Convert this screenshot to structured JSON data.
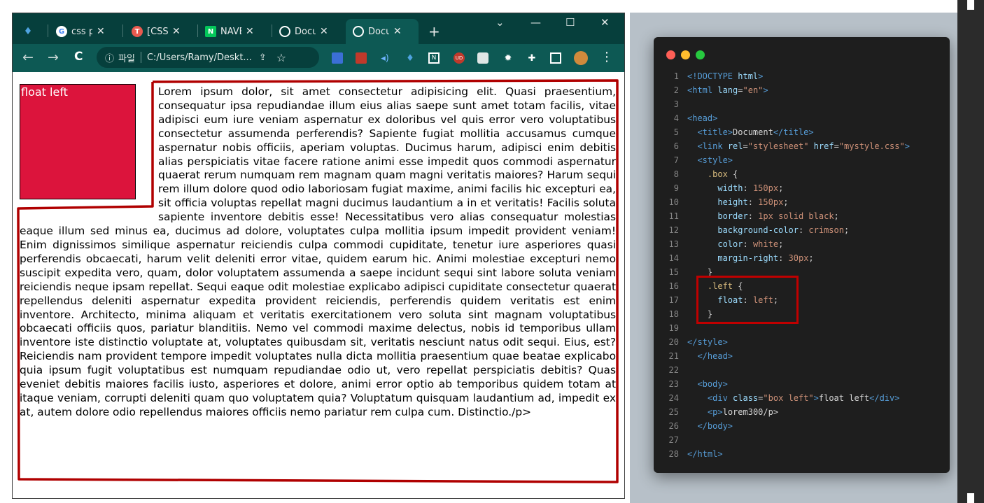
{
  "browser": {
    "tabs": [
      {
        "label": "",
        "icon": "diamond-icon",
        "color": "#4fa3e0"
      },
      {
        "label": "css pc",
        "icon": "google-icon",
        "color": "#ffffff"
      },
      {
        "label": "[CSS",
        "icon": "tistory-icon",
        "color": "#e85a4f"
      },
      {
        "label": "NAVE",
        "icon": "naver-icon",
        "color": "#03c75a"
      },
      {
        "label": "Docu",
        "icon": "globe-icon",
        "color": "#ffffff"
      },
      {
        "label": "Docu",
        "icon": "globe-icon",
        "color": "#ffffff",
        "active": true
      }
    ],
    "new_tab": "+",
    "close_glyph": "✕",
    "window_controls": {
      "dropdown": "⌄",
      "minimize": "—",
      "maximize": "☐",
      "close": "✕"
    },
    "toolbar": {
      "back": "←",
      "forward": "→",
      "reload": "C",
      "info_glyph": "ⓘ",
      "scheme": "파일",
      "url": "C:/Users/Ramy/Deskt...",
      "share_glyph": "⇪",
      "star_glyph": "☆",
      "menu_glyph": "⋮"
    },
    "page": {
      "float_box_text": "float left",
      "paragraph": "Lorem ipsum dolor, sit amet consectetur adipisicing elit. Quasi praesentium, consequatur ipsa repudiandae illum eius alias saepe sunt amet totam facilis, vitae adipisci eum iure veniam aspernatur ex doloribus vel quis error vero voluptatibus consectetur assumenda perferendis? Sapiente fugiat mollitia accusamus cumque aspernatur nobis officiis, aperiam voluptas. Ducimus harum, adipisci enim debitis alias perspiciatis vitae facere ratione animi esse impedit quos commodi aspernatur quaerat rerum numquam rem magnam quam magni veritatis maiores? Harum sequi rem illum dolore quod odio laboriosam fugiat maxime, animi facilis hic excepturi ea, sit officia voluptas repellat magni ducimus laudantium a in et veritatis! Facilis soluta sapiente inventore debitis esse! Necessitatibus vero alias consequatur molestias eaque illum sed minus ea, ducimus ad dolore, voluptates culpa mollitia ipsum impedit provident veniam! Enim dignissimos similique aspernatur reiciendis culpa commodi cupiditate, tenetur iure asperiores quasi perferendis obcaecati, harum velit deleniti error vitae, quidem earum hic. Animi molestiae excepturi nemo suscipit expedita vero, quam, dolor voluptatem assumenda a saepe incidunt sequi sint labore soluta veniam reiciendis neque ipsam repellat. Sequi eaque odit molestiae explicabo adipisci cupiditate consectetur quaerat repellendus deleniti aspernatur expedita provident reiciendis, perferendis quidem veritatis est enim inventore. Architecto, minima aliquam et veritatis exercitationem vero soluta sint magnam voluptatibus obcaecati officiis quos, pariatur blanditiis. Nemo vel commodi maxime delectus, nobis id temporibus ullam inventore iste distinctio voluptate at, voluptates quibusdam sit, veritatis nesciunt natus odit sequi. Eius, est? Reiciendis nam provident tempore impedit voluptates nulla dicta mollitia praesentium quae beatae explicabo quia ipsum fugit voluptatibus est numquam repudiandae odio ut, vero repellat perspiciatis debitis? Quas eveniet debitis maiores facilis iusto, asperiores et dolore, animi error optio ab temporibus quidem totam at itaque veniam, corrupti deleniti quam quo voluptatem quia? Voluptatum quisquam laudantium ad, impedit ex at, autem dolore odio repellendus maiores officiis nemo pariatur rem culpa cum. Distinctio./p>"
    },
    "highlight_color": "#b00000"
  },
  "code": {
    "lines": [
      {
        "n": "1",
        "parts": [
          [
            "tg",
            "<!DOCTYPE "
          ],
          [
            "at",
            "html"
          ],
          [
            "tg",
            ">"
          ]
        ]
      },
      {
        "n": "2",
        "parts": [
          [
            "tg",
            "<html "
          ],
          [
            "at",
            "lang"
          ],
          [
            "tx",
            "="
          ],
          [
            "st",
            "\"en\""
          ],
          [
            "tg",
            ">"
          ]
        ]
      },
      {
        "n": "3",
        "parts": []
      },
      {
        "n": "4",
        "parts": [
          [
            "tg",
            "<head>"
          ]
        ]
      },
      {
        "n": "5",
        "parts": [
          [
            "tx",
            "  "
          ],
          [
            "tg",
            "<title>"
          ],
          [
            "tx",
            "Document"
          ],
          [
            "tg",
            "</title>"
          ]
        ]
      },
      {
        "n": "6",
        "parts": [
          [
            "tx",
            "  "
          ],
          [
            "tg",
            "<link "
          ],
          [
            "at",
            "rel"
          ],
          [
            "tx",
            "="
          ],
          [
            "st",
            "\"stylesheet\""
          ],
          [
            "tx",
            " "
          ],
          [
            "at",
            "href"
          ],
          [
            "tx",
            "="
          ],
          [
            "st",
            "\"mystyle.css\""
          ],
          [
            "tg",
            ">"
          ]
        ]
      },
      {
        "n": "7",
        "parts": [
          [
            "tx",
            "  "
          ],
          [
            "tg",
            "<style>"
          ]
        ]
      },
      {
        "n": "8",
        "parts": [
          [
            "tx",
            "    "
          ],
          [
            "sel",
            ".box"
          ],
          [
            "tx",
            " {"
          ]
        ]
      },
      {
        "n": "9",
        "parts": [
          [
            "tx",
            "      "
          ],
          [
            "pr",
            "width"
          ],
          [
            "tx",
            ": "
          ],
          [
            "vl",
            "150px"
          ],
          [
            "tx",
            ";"
          ]
        ]
      },
      {
        "n": "10",
        "parts": [
          [
            "tx",
            "      "
          ],
          [
            "pr",
            "height"
          ],
          [
            "tx",
            ": "
          ],
          [
            "vl",
            "150px"
          ],
          [
            "tx",
            ";"
          ]
        ]
      },
      {
        "n": "11",
        "parts": [
          [
            "tx",
            "      "
          ],
          [
            "pr",
            "border"
          ],
          [
            "tx",
            ": "
          ],
          [
            "vl",
            "1px solid black"
          ],
          [
            "tx",
            ";"
          ]
        ]
      },
      {
        "n": "12",
        "parts": [
          [
            "tx",
            "      "
          ],
          [
            "pr",
            "background-color"
          ],
          [
            "tx",
            ": "
          ],
          [
            "vl",
            "crimson"
          ],
          [
            "tx",
            ";"
          ]
        ]
      },
      {
        "n": "13",
        "parts": [
          [
            "tx",
            "      "
          ],
          [
            "pr",
            "color"
          ],
          [
            "tx",
            ": "
          ],
          [
            "vl",
            "white"
          ],
          [
            "tx",
            ";"
          ]
        ]
      },
      {
        "n": "14",
        "parts": [
          [
            "tx",
            "      "
          ],
          [
            "pr",
            "margin-right"
          ],
          [
            "tx",
            ": "
          ],
          [
            "vl",
            "30px"
          ],
          [
            "tx",
            ";"
          ]
        ]
      },
      {
        "n": "15",
        "parts": [
          [
            "tx",
            "    }"
          ]
        ]
      },
      {
        "n": "16",
        "parts": [
          [
            "tx",
            "    "
          ],
          [
            "sel",
            ".left"
          ],
          [
            "tx",
            " {"
          ]
        ]
      },
      {
        "n": "17",
        "parts": [
          [
            "tx",
            "      "
          ],
          [
            "pr",
            "float"
          ],
          [
            "tx",
            ": "
          ],
          [
            "vl",
            "left"
          ],
          [
            "tx",
            ";"
          ]
        ]
      },
      {
        "n": "18",
        "parts": [
          [
            "tx",
            "    }"
          ]
        ]
      },
      {
        "n": "19",
        "parts": []
      },
      {
        "n": "20",
        "parts": [
          [
            "tg",
            "</style>"
          ]
        ]
      },
      {
        "n": "21",
        "parts": [
          [
            "tx",
            "  "
          ],
          [
            "tg",
            "</head>"
          ]
        ]
      },
      {
        "n": "22",
        "parts": []
      },
      {
        "n": "23",
        "parts": [
          [
            "tx",
            "  "
          ],
          [
            "tg",
            "<body>"
          ]
        ]
      },
      {
        "n": "24",
        "parts": [
          [
            "tx",
            "    "
          ],
          [
            "tg",
            "<div "
          ],
          [
            "at",
            "class"
          ],
          [
            "tx",
            "="
          ],
          [
            "st",
            "\"box left\""
          ],
          [
            "tg",
            ">"
          ],
          [
            "tx",
            "float left"
          ],
          [
            "tg",
            "</div>"
          ]
        ]
      },
      {
        "n": "25",
        "parts": [
          [
            "tx",
            "    "
          ],
          [
            "tg",
            "<p>"
          ],
          [
            "tx",
            "lorem300/p>"
          ]
        ]
      },
      {
        "n": "26",
        "parts": [
          [
            "tx",
            "  "
          ],
          [
            "tg",
            "</body>"
          ]
        ]
      },
      {
        "n": "27",
        "parts": []
      },
      {
        "n": "28",
        "parts": [
          [
            "tg",
            "</html>"
          ]
        ]
      }
    ],
    "dot_colors": [
      "#ff5f56",
      "#ffbd2e",
      "#27c93f"
    ],
    "highlight_color": "#c00000"
  }
}
